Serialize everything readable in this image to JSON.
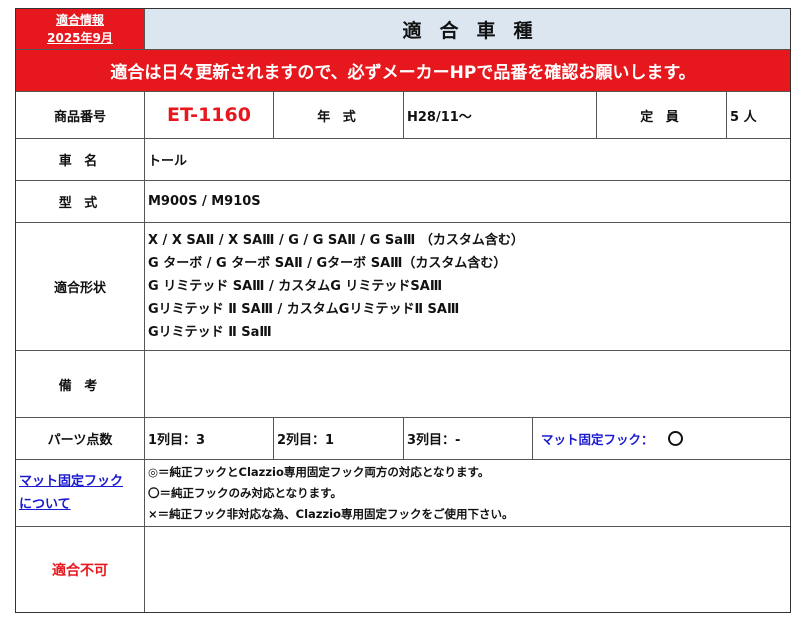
{
  "badge": {
    "line1": "適合情報",
    "line2": "2025年9月"
  },
  "heading": "適合車種",
  "banner": "適合は日々更新されますので、必ずメーカーHPで品番を確認お願いします。",
  "spec": {
    "product_label": "商品番号",
    "product_value": "ET-1160",
    "year_label": "年 式",
    "year_value": "H28/11～",
    "capacity_label": "定 員",
    "capacity_value": "5 人"
  },
  "car_name": {
    "label": "車 名",
    "value": "トール"
  },
  "model": {
    "label": "型 式",
    "value": "M900S / M910S"
  },
  "fit_shapes": {
    "label": "適合形状",
    "lines": [
      "X / X SAⅡ / X SAⅢ / G / G SAⅡ / G SaⅢ （カスタム含む）",
      "G ターボ / G ターボ SAⅡ / Gターボ SAⅢ（カスタム含む）",
      "G リミテッド SAⅢ / カスタムG リミテッドSAⅢ",
      "Gリミテッド Ⅱ SAⅢ / カスタムGリミテッドⅡ SAⅢ",
      "Gリミテッド Ⅱ SaⅢ"
    ]
  },
  "remarks": {
    "label": "備 考",
    "value": ""
  },
  "parts": {
    "label": "パーツ点数",
    "row1": "1列目：3",
    "row2": "2列目：1",
    "row3": "3列目：-",
    "hook_label": "マット固定フック："
  },
  "hook_info": {
    "label_line1": "マット固定フック",
    "label_line2": "について",
    "notes": [
      "◎＝純正フックとClazzio専用固定フック両方の対応となります。",
      "〇＝純正フックのみ対応となります。",
      "×＝純正フック非対応な為、Clazzio専用固定フックをご使用下さい。"
    ]
  },
  "not_fit": {
    "label": "適合不可",
    "value": ""
  }
}
